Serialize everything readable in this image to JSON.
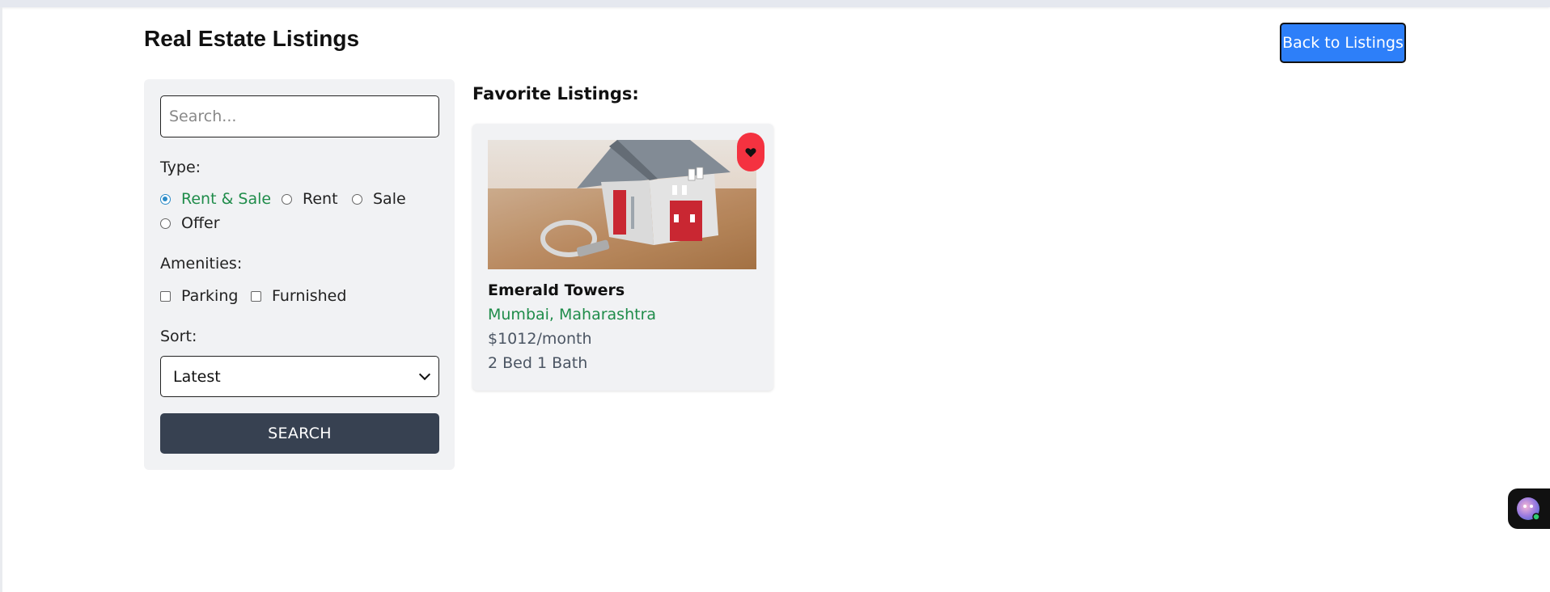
{
  "header": {
    "title": "Real Estate Listings",
    "back_label": "Back to Listings"
  },
  "filters": {
    "search_placeholder": "Search...",
    "type_label": "Type:",
    "type_options": [
      "Rent & Sale",
      "Rent",
      "Sale",
      "Offer"
    ],
    "type_selected": "Rent & Sale",
    "amenities_label": "Amenities:",
    "amenities": [
      "Parking",
      "Furnished"
    ],
    "sort_label": "Sort:",
    "sort_value": "Latest",
    "search_button": "SEARCH"
  },
  "favorites": {
    "heading": "Favorite Listings:",
    "listings": [
      {
        "name": "Emerald Towers",
        "location": "Mumbai, Maharashtra",
        "price": "$1012/month",
        "details": "2 Bed 1 Bath",
        "favorited": true
      }
    ]
  },
  "colors": {
    "accent_blue": "#2d7ff9",
    "button_dark": "#374151",
    "green_text": "#1f8c4a",
    "heart_red": "#f43240"
  },
  "icons": [
    "heart-icon",
    "chevron-down-icon",
    "assistant-avatar-icon"
  ]
}
